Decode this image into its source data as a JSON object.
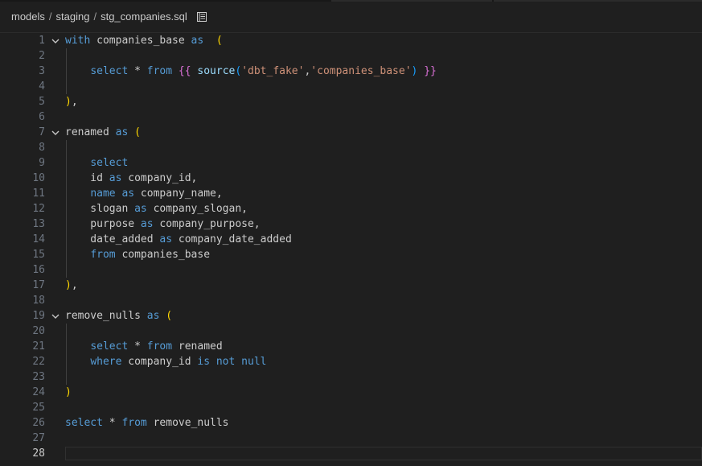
{
  "breadcrumb": {
    "items": [
      "models",
      "staging",
      "stg_companies.sql"
    ],
    "separator": "/"
  },
  "icons": {
    "outline": "outline-list-icon",
    "fold": "chevron-down-icon"
  },
  "colors": {
    "background": "#1f1f1f",
    "keyword": "#569cd6",
    "identifier": "#cccccc",
    "string": "#ce9178",
    "bracket_gold": "#ffd700",
    "bracket_orchid": "#da70d6",
    "bracket_blue": "#179fff",
    "line_number": "#6e7681"
  },
  "editor": {
    "active_line": 28,
    "foldable_lines": [
      1,
      7,
      19
    ],
    "lines": [
      {
        "n": "1",
        "tokens": [
          {
            "t": "with",
            "c": "kw"
          },
          {
            "t": " companies_base ",
            "c": "id"
          },
          {
            "t": "as",
            "c": "kw"
          },
          {
            "t": "  ",
            "c": "id"
          },
          {
            "t": "(",
            "c": "p1"
          }
        ]
      },
      {
        "n": "2",
        "tokens": []
      },
      {
        "n": "3",
        "tokens": [
          {
            "t": "    ",
            "c": "id"
          },
          {
            "t": "select",
            "c": "kw"
          },
          {
            "t": " * ",
            "c": "id"
          },
          {
            "t": "from",
            "c": "kw"
          },
          {
            "t": " ",
            "c": "id"
          },
          {
            "t": "{{",
            "c": "p2"
          },
          {
            "t": " ",
            "c": "id"
          },
          {
            "t": "source",
            "c": "fn"
          },
          {
            "t": "(",
            "c": "p3"
          },
          {
            "t": "'dbt_fake'",
            "c": "str"
          },
          {
            "t": ",",
            "c": "id"
          },
          {
            "t": "'companies_base'",
            "c": "str"
          },
          {
            "t": ")",
            "c": "p3"
          },
          {
            "t": " ",
            "c": "id"
          },
          {
            "t": "}}",
            "c": "p2"
          }
        ]
      },
      {
        "n": "4",
        "tokens": []
      },
      {
        "n": "5",
        "tokens": [
          {
            "t": ")",
            "c": "p1"
          },
          {
            "t": ",",
            "c": "id"
          }
        ]
      },
      {
        "n": "6",
        "tokens": []
      },
      {
        "n": "7",
        "tokens": [
          {
            "t": "renamed ",
            "c": "id"
          },
          {
            "t": "as",
            "c": "kw"
          },
          {
            "t": " ",
            "c": "id"
          },
          {
            "t": "(",
            "c": "p1"
          }
        ]
      },
      {
        "n": "8",
        "tokens": []
      },
      {
        "n": "9",
        "tokens": [
          {
            "t": "    ",
            "c": "id"
          },
          {
            "t": "select",
            "c": "kw"
          }
        ]
      },
      {
        "n": "10",
        "tokens": [
          {
            "t": "    id ",
            "c": "id"
          },
          {
            "t": "as",
            "c": "kw"
          },
          {
            "t": " company_id,",
            "c": "id"
          }
        ]
      },
      {
        "n": "11",
        "tokens": [
          {
            "t": "    ",
            "c": "id"
          },
          {
            "t": "name",
            "c": "kw"
          },
          {
            "t": " ",
            "c": "id"
          },
          {
            "t": "as",
            "c": "kw"
          },
          {
            "t": " company_name,",
            "c": "id"
          }
        ]
      },
      {
        "n": "12",
        "tokens": [
          {
            "t": "    slogan ",
            "c": "id"
          },
          {
            "t": "as",
            "c": "kw"
          },
          {
            "t": " company_slogan,",
            "c": "id"
          }
        ]
      },
      {
        "n": "13",
        "tokens": [
          {
            "t": "    purpose ",
            "c": "id"
          },
          {
            "t": "as",
            "c": "kw"
          },
          {
            "t": " company_purpose,",
            "c": "id"
          }
        ]
      },
      {
        "n": "14",
        "tokens": [
          {
            "t": "    date_added ",
            "c": "id"
          },
          {
            "t": "as",
            "c": "kw"
          },
          {
            "t": " company_date_added",
            "c": "id"
          }
        ]
      },
      {
        "n": "15",
        "tokens": [
          {
            "t": "    ",
            "c": "id"
          },
          {
            "t": "from",
            "c": "kw"
          },
          {
            "t": " companies_base",
            "c": "id"
          }
        ]
      },
      {
        "n": "16",
        "tokens": []
      },
      {
        "n": "17",
        "tokens": [
          {
            "t": ")",
            "c": "p1"
          },
          {
            "t": ",",
            "c": "id"
          }
        ]
      },
      {
        "n": "18",
        "tokens": []
      },
      {
        "n": "19",
        "tokens": [
          {
            "t": "remove_nulls ",
            "c": "id"
          },
          {
            "t": "as",
            "c": "kw"
          },
          {
            "t": " ",
            "c": "id"
          },
          {
            "t": "(",
            "c": "p1"
          }
        ]
      },
      {
        "n": "20",
        "tokens": []
      },
      {
        "n": "21",
        "tokens": [
          {
            "t": "    ",
            "c": "id"
          },
          {
            "t": "select",
            "c": "kw"
          },
          {
            "t": " * ",
            "c": "id"
          },
          {
            "t": "from",
            "c": "kw"
          },
          {
            "t": " renamed",
            "c": "id"
          }
        ]
      },
      {
        "n": "22",
        "tokens": [
          {
            "t": "    ",
            "c": "id"
          },
          {
            "t": "where",
            "c": "kw"
          },
          {
            "t": " company_id ",
            "c": "id"
          },
          {
            "t": "is",
            "c": "kw"
          },
          {
            "t": " ",
            "c": "id"
          },
          {
            "t": "not",
            "c": "kw"
          },
          {
            "t": " ",
            "c": "id"
          },
          {
            "t": "null",
            "c": "kw"
          }
        ]
      },
      {
        "n": "23",
        "tokens": []
      },
      {
        "n": "24",
        "tokens": [
          {
            "t": ")",
            "c": "p1"
          }
        ]
      },
      {
        "n": "25",
        "tokens": []
      },
      {
        "n": "26",
        "tokens": [
          {
            "t": "select",
            "c": "kw"
          },
          {
            "t": " * ",
            "c": "id"
          },
          {
            "t": "from",
            "c": "kw"
          },
          {
            "t": " remove_nulls",
            "c": "id"
          }
        ]
      },
      {
        "n": "27",
        "tokens": []
      },
      {
        "n": "28",
        "tokens": []
      }
    ]
  }
}
